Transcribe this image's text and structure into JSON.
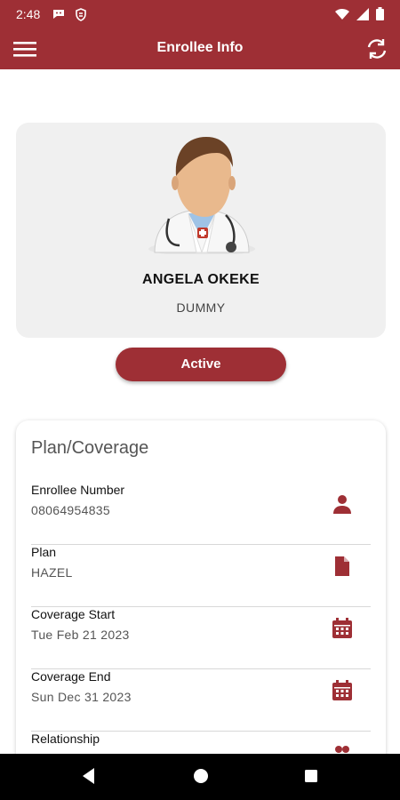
{
  "status_bar": {
    "time": "2:48"
  },
  "app_bar": {
    "title": "Enrollee Info"
  },
  "profile": {
    "name": "ANGELA OKEKE",
    "subtitle": "DUMMY",
    "status_label": "Active"
  },
  "plan_card": {
    "title": "Plan/Coverage",
    "rows": [
      {
        "label": "Enrollee Number",
        "value": "08064954835",
        "icon": "person-icon"
      },
      {
        "label": "Plan",
        "value": "HAZEL",
        "icon": "document-icon"
      },
      {
        "label": "Coverage Start",
        "value": "Tue Feb 21 2023",
        "icon": "calendar-icon"
      },
      {
        "label": "Coverage End",
        "value": "Sun Dec 31 2023",
        "icon": "calendar-icon"
      },
      {
        "label": "Relationship",
        "value": "",
        "icon": "people-icon"
      }
    ]
  },
  "colors": {
    "primary": "#9e2f35",
    "card_bg": "#f0f0f0"
  }
}
